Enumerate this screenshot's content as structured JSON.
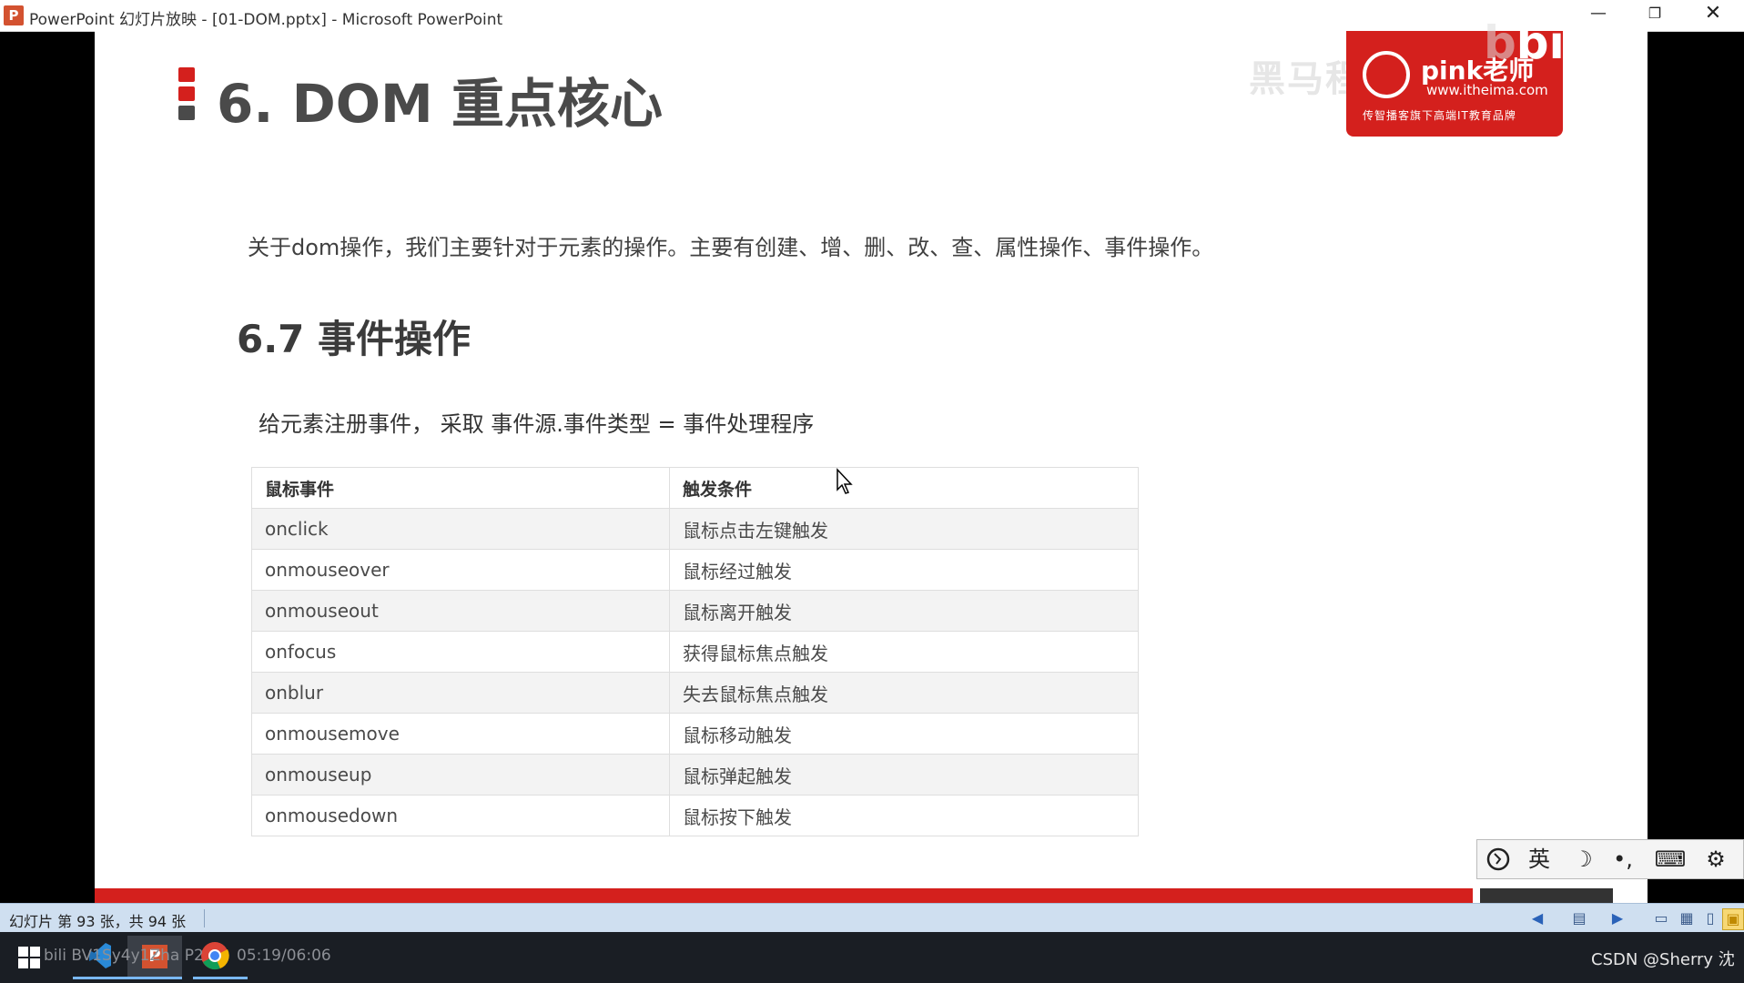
{
  "window": {
    "app_icon": "P",
    "title": "PowerPoint 幻灯片放映 - [01-DOM.pptx] - Microsoft PowerPoint",
    "minimize": "—",
    "restore": "❐",
    "close": "✕"
  },
  "slide": {
    "heading": "6. DOM 重点核心",
    "intro": "关于dom操作，我们主要针对于元素的操作。主要有创建、增、删、改、查、属性操作、事件操作。",
    "subheading": "6.7 事件操作",
    "rule": "给元素注册事件， 采取 事件源.事件类型 = 事件处理程序",
    "table": {
      "headers": [
        "鼠标事件",
        "触发条件"
      ],
      "rows": [
        [
          "onclick",
          "鼠标点击左键触发"
        ],
        [
          "onmouseover",
          "鼠标经过触发"
        ],
        [
          "onmouseout",
          "鼠标离开触发"
        ],
        [
          "onfocus",
          "获得鼠标焦点触发"
        ],
        [
          "onblur",
          "失去鼠标焦点触发"
        ],
        [
          "onmousemove",
          "鼠标移动触发"
        ],
        [
          "onmouseup",
          "鼠标弹起触发"
        ],
        [
          "onmousedown",
          "鼠标按下触发"
        ]
      ]
    },
    "brand": {
      "name": "pink老师",
      "url": "www.itheima.com",
      "slogan": "传智播客旗下高端IT教育品牌",
      "watermark": "黑马程序员",
      "bili": "bili"
    },
    "marker_colors": [
      "#d4201d",
      "#4a4a4a"
    ],
    "accent_color": "#d4201d"
  },
  "ime": {
    "lang": "英",
    "items": [
      "moon-icon",
      "punctuation-icon",
      "keyboard-icon",
      "gear-icon"
    ]
  },
  "statusbar": {
    "slide_counter": "幻灯片 第 93 张，共 94 张"
  },
  "taskbar": {
    "overlay_text": "bili BV1Sy4y1Zha P2",
    "time_text": "05:19/06:06",
    "csdn": "CSDN @Sherry 沈"
  }
}
